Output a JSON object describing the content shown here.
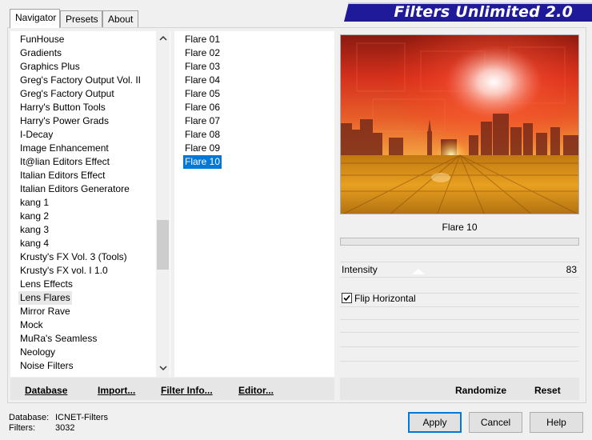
{
  "tabs": [
    {
      "label": "Navigator"
    },
    {
      "label": "Presets"
    },
    {
      "label": "About"
    }
  ],
  "banner": {
    "title": "Filters Unlimited 2.0"
  },
  "categories": [
    "FunHouse",
    "Gradients",
    "Graphics Plus",
    "Greg's Factory Output Vol. II",
    "Greg's Factory Output",
    "Harry's Button Tools",
    "Harry's Power Grads",
    "I-Decay",
    "Image Enhancement",
    "It@lian Editors Effect",
    "Italian Editors Effect",
    "Italian Editors Generatore",
    "kang 1",
    "kang 2",
    "kang 3",
    "kang 4",
    "Krusty's FX Vol. 3 (Tools)",
    "Krusty's FX vol. I 1.0",
    "Lens Effects",
    "Lens Flares",
    "Mirror Rave",
    "Mock",
    "MuRa's Seamless",
    "Neology",
    "Noise Filters"
  ],
  "selected_category": "Lens Flares",
  "filters": [
    "Flare 01",
    "Flare 02",
    "Flare 03",
    "Flare 04",
    "Flare 05",
    "Flare 06",
    "Flare 07",
    "Flare 08",
    "Flare 09",
    "Flare 10"
  ],
  "selected_filter": "Flare 10",
  "preview": {
    "filter_name": "Flare 10"
  },
  "params": {
    "intensity_label": "Intensity",
    "intensity_value": "83",
    "flip_label": "Flip Horizontal",
    "flip_checked": true
  },
  "actions": {
    "database": "Database",
    "import": "Import...",
    "filter_info": "Filter Info...",
    "editor": "Editor...",
    "randomize": "Randomize",
    "reset": "Reset"
  },
  "footer": {
    "database_label": "Database:",
    "database_value": "ICNET-Filters",
    "filters_label": "Filters:",
    "filters_value": "3032",
    "apply": "Apply",
    "cancel": "Cancel",
    "help": "Help"
  },
  "icons": {
    "scroll_up": "chevron-up-icon",
    "scroll_down": "chevron-down-icon",
    "checkbox": "check-icon"
  }
}
